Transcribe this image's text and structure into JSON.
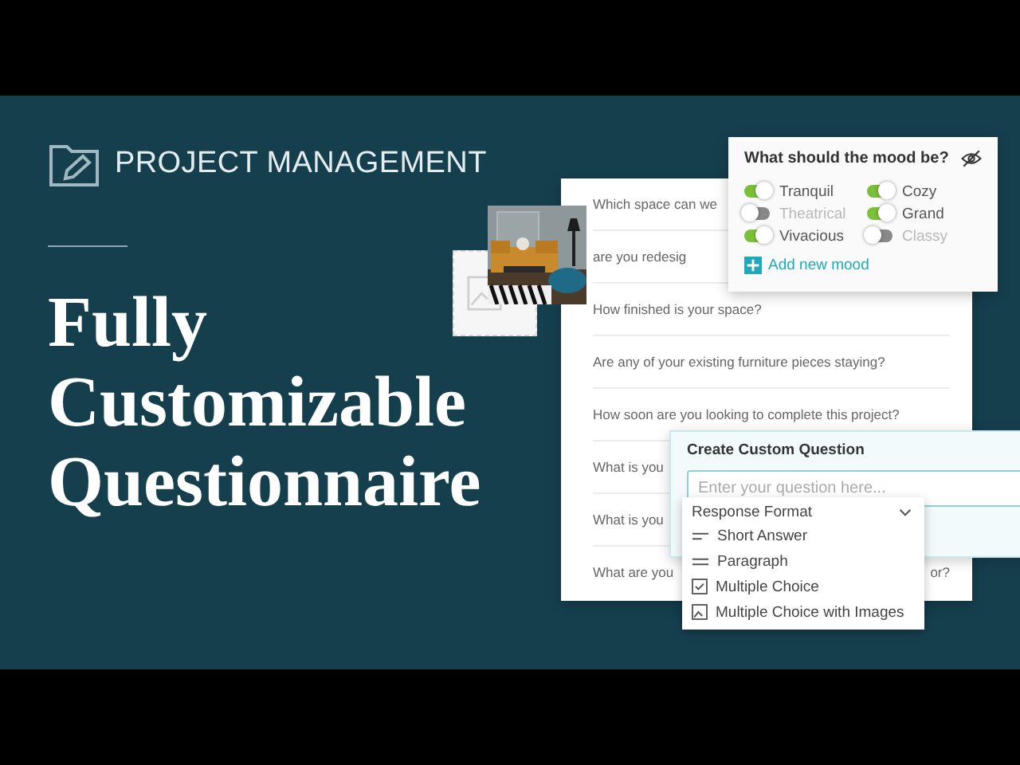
{
  "brand": {
    "label": "PROJECT MANAGEMENT"
  },
  "headline": [
    "Fully",
    "Customizable",
    "Questionnaire"
  ],
  "questions": [
    {
      "text": "Which space can we"
    },
    {
      "text": "are you redesig"
    },
    {
      "text": "How finished is your space?"
    },
    {
      "text": "Are any of your existing furniture pieces staying?"
    },
    {
      "text": "How soon are you looking to complete this project?"
    },
    {
      "text": "What is you"
    },
    {
      "text": "What is you"
    },
    {
      "text": "What are you",
      "tail": "or?"
    }
  ],
  "photo": {
    "kind": "picture"
  },
  "mood": {
    "title": "What should the mood be?",
    "options": [
      {
        "label": "Tranquil",
        "on": true
      },
      {
        "label": "Theatrical",
        "on": false
      },
      {
        "label": "Vivacious",
        "on": true
      },
      {
        "label": "Cozy",
        "on": true
      },
      {
        "label": "Grand",
        "on": true
      },
      {
        "label": "Classy",
        "on": false
      }
    ],
    "add_label": "Add new mood"
  },
  "custom_question": {
    "title": "Create Custom Question",
    "placeholder": "Enter your question here...",
    "format_label": "Response Format",
    "formats": [
      {
        "kind": "short",
        "label": "Short Answer"
      },
      {
        "kind": "paragraph",
        "label": "Paragraph"
      },
      {
        "kind": "choice",
        "label": "Multiple Choice"
      },
      {
        "kind": "images",
        "label": "Multiple Choice with Images"
      }
    ]
  }
}
